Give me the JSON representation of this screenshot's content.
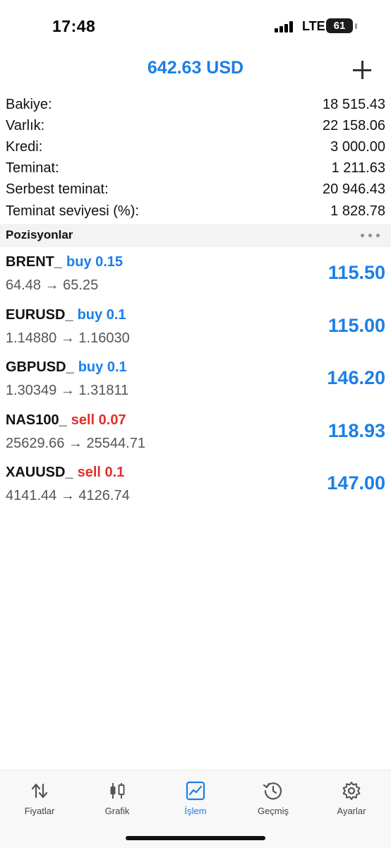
{
  "status_bar": {
    "time": "17:48",
    "network": "LTE",
    "battery": "61"
  },
  "header": {
    "title": "642.63 USD",
    "add_icon": "plus-icon"
  },
  "summary": [
    {
      "label": "Bakiye:",
      "value": "18 515.43"
    },
    {
      "label": "Varlık:",
      "value": "22 158.06"
    },
    {
      "label": "Kredi:",
      "value": "3 000.00"
    },
    {
      "label": "Teminat:",
      "value": "1 211.63"
    },
    {
      "label": "Serbest teminat:",
      "value": "20 946.43"
    },
    {
      "label": "Teminat seviyesi (%):",
      "value": "1 828.78"
    }
  ],
  "positions_header": {
    "title": "Pozisyonlar",
    "more_icon": "more-horizontal-icon"
  },
  "positions": [
    {
      "symbol": "BRENT_",
      "side": "buy 0.15",
      "prices": "64.48 → 65.25",
      "profit": "115.50"
    },
    {
      "symbol": "EURUSD_",
      "side": "buy 0.1",
      "prices": "1.14880 → 1.16030",
      "profit": "115.00"
    },
    {
      "symbol": "GBPUSD_",
      "side": "buy 0.1",
      "prices": "1.30349 → 1.31811",
      "profit": "146.20"
    },
    {
      "symbol": "NAS100_",
      "side": "sell 0.07",
      "prices": "25629.66 → 25544.71",
      "profit": "118.93"
    },
    {
      "symbol": "XAUUSD_",
      "side": "sell 0.1",
      "prices": "4141.44 → 4126.74",
      "profit": "147.00"
    }
  ],
  "tabs": [
    {
      "label": "Fiyatlar",
      "icon": "arrows-up-down-icon",
      "active": false
    },
    {
      "label": "Grafik",
      "icon": "candlestick-icon",
      "active": false
    },
    {
      "label": "İşlem",
      "icon": "trade-chart-icon",
      "active": true
    },
    {
      "label": "Geçmiş",
      "icon": "history-icon",
      "active": false
    },
    {
      "label": "Ayarlar",
      "icon": "gear-icon",
      "active": false
    }
  ],
  "colors": {
    "accent": "#1b7fe6",
    "sell": "#e0302a",
    "buy": "#1b7fe6"
  }
}
